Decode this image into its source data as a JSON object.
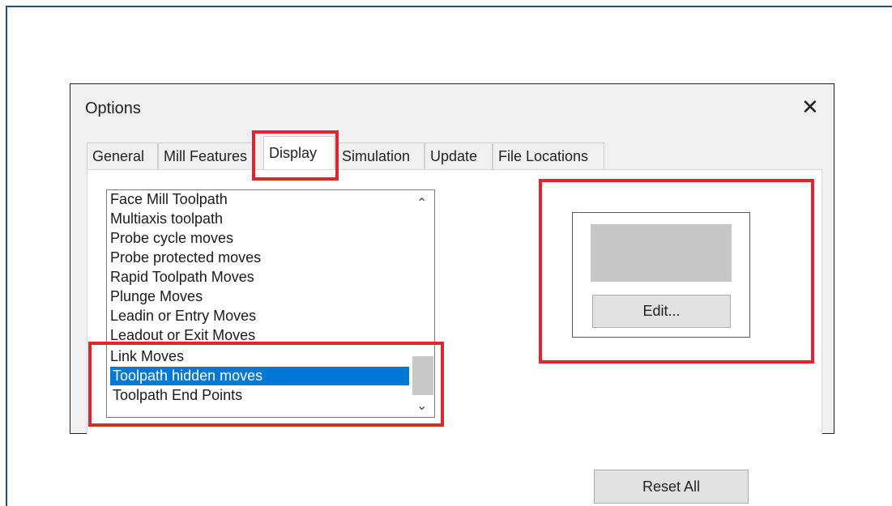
{
  "dialog": {
    "title": "Options",
    "close_glyph": "✕"
  },
  "tabs": [
    {
      "label": "General"
    },
    {
      "label": "Mill Features"
    },
    {
      "label": "Display",
      "active": true
    },
    {
      "label": "Simulation"
    },
    {
      "label": "Update"
    },
    {
      "label": "File Locations"
    }
  ],
  "toolpath_list": {
    "items": [
      {
        "label": "Face Mill Toolpath"
      },
      {
        "label": "Multiaxis toolpath"
      },
      {
        "label": "Probe cycle moves"
      },
      {
        "label": "Probe protected moves"
      },
      {
        "label": "Rapid Toolpath Moves"
      },
      {
        "label": "Plunge Moves"
      },
      {
        "label": "Leadin or Entry Moves"
      },
      {
        "label": "Leadout or Exit Moves"
      },
      {
        "label": "Link Moves"
      },
      {
        "label": "Toolpath hidden moves",
        "selected": true
      },
      {
        "label": "Toolpath End Points"
      }
    ],
    "scroll_up_glyph": "⌃",
    "scroll_down_glyph": "⌄"
  },
  "color_preview": {
    "swatch_color": "#c6c6c6",
    "edit_label": "Edit..."
  },
  "reset_all_label": "Reset All",
  "colors": {
    "highlight": "#e0262d",
    "selection": "#0078d7",
    "frame": "#1f4e79"
  }
}
